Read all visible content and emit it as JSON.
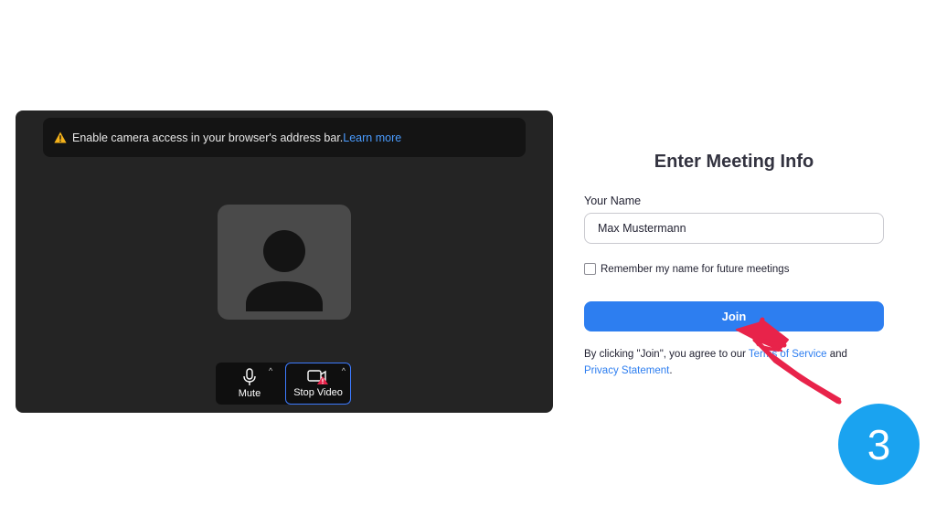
{
  "preview": {
    "banner_text": "Enable camera access in your browser's address bar.",
    "banner_link": "Learn more",
    "controls": {
      "mute_label": "Mute",
      "video_label": "Stop Video",
      "caret": "^"
    }
  },
  "form": {
    "title": "Enter Meeting Info",
    "name_label": "Your Name",
    "name_value": "Max Mustermann",
    "remember_label": "Remember my name for future meetings",
    "remember_checked": false,
    "join_label": "Join",
    "terms_prefix": "By clicking \"Join\", you agree to our ",
    "terms_link": "Terms of Service",
    "terms_and": " and",
    "privacy_link": "Privacy Statement",
    "terms_suffix": "."
  },
  "annotation": {
    "step_number": "3"
  },
  "colors": {
    "accent": "#2d7ef0",
    "warning": "#f5b21a",
    "annotation_arrow": "#e8234a",
    "step_badge": "#1aa3f0"
  },
  "icons": {
    "warning": "warning-triangle-icon",
    "avatar": "person-avatar-icon",
    "microphone": "microphone-icon",
    "video": "video-camera-icon",
    "checkbox": "checkbox-icon"
  }
}
